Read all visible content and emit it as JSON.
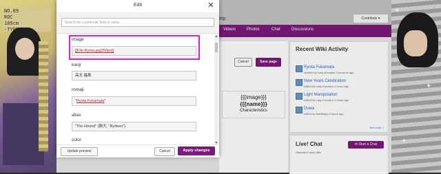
{
  "background": {
    "help_text": "elp",
    "contribute_label": "Contribute",
    "nav": [
      "Videos",
      "Photos",
      "Chat",
      "Discussions"
    ],
    "cancel_label": "Cancel",
    "save_label": "Save page",
    "infobox": {
      "image": "{{{image}}}",
      "name": "{{{name}}}",
      "caption": "Characteristics"
    },
    "mugshot_text": "NO.69\nROC\n189cm\n-TYPE",
    "activity": {
      "title": "Recent Wiki Activity",
      "items": [
        {
          "title": "Ryota Fukamata",
          "meta": "created by Lady Komainu 3 seconds ago"
        },
        {
          "title": "New Years Celebration",
          "meta": "edited by Lady Komainu 4 hours ago"
        },
        {
          "title": "Light Manipulation",
          "meta": "edited by Lady Komainu 4 hours ago"
        },
        {
          "title": "Duwa",
          "meta": "edited by Dalvikbjsy 4 hours ago"
        }
      ],
      "see_more": "See more >"
    },
    "livechat": {
      "title": "Live! Chat",
      "subtitle": "Nanbaka Fanon Wiki",
      "button": "Start a Chat"
    }
  },
  "modal": {
    "title": "Edit",
    "search_placeholder": "Search for a particular field or value",
    "fields": [
      {
        "label": "image",
        "value": "[[File:Ryota.jpg|250px]]"
      },
      {
        "label": "kanji",
        "value": "高太 福島"
      },
      {
        "label": "romaji",
        "value": "Ryota Fukamata"
      },
      {
        "label": "alias",
        "value": "\"The Hound\" (猟犬, \"Ryōken\")"
      },
      {
        "label": "color",
        "value": ""
      }
    ],
    "update_preview": "Update preview",
    "cancel": "Cancel",
    "apply": "Apply changes"
  },
  "colors": {
    "accent": "#7b1a7b",
    "highlight": "#e01be0",
    "link": "#3366cc"
  }
}
